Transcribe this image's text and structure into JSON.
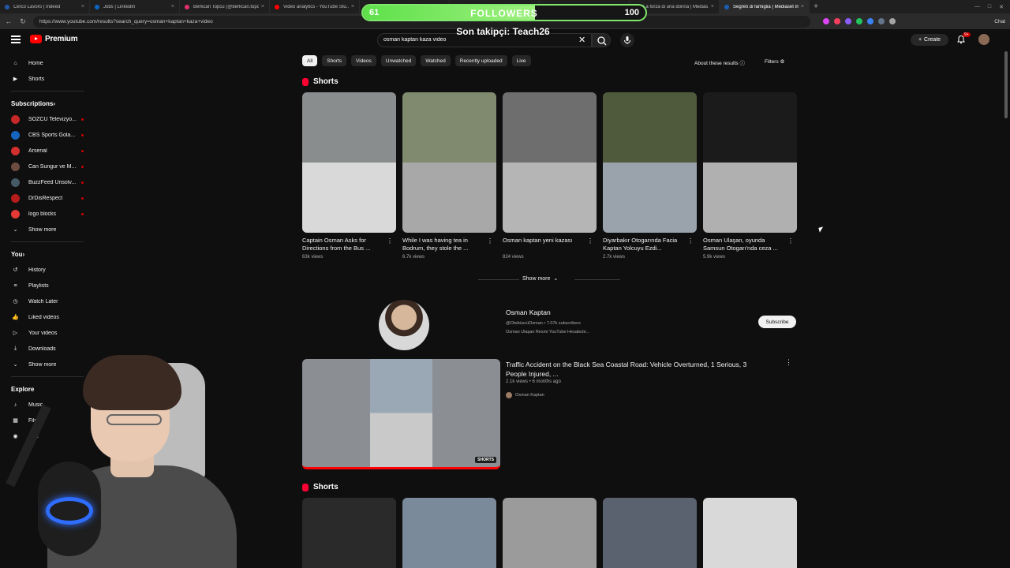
{
  "browser": {
    "tabs": [
      {
        "title": "Cerco Lavoro | Indeed",
        "color": "#2557a7"
      },
      {
        "title": "Jobs | LinkedIn",
        "color": "#0a66c2"
      },
      {
        "title": "Berkcan Topcu (@berkcan.topc...",
        "color": "#e1306c"
      },
      {
        "title": "Video analytics - YouTube Stu...",
        "color": "#ff0000"
      },
      {
        "title": "",
        "color": "#333"
      },
      {
        "title": "Canale 5: video, puntate, pal...",
        "color": "#1a5fb4"
      },
      {
        "title": "Innocence | Mediaset Infinity",
        "color": "#1a5fb4"
      },
      {
        "title": "La forza di una donna | Medias...",
        "color": "#1a5fb4"
      },
      {
        "title": "Segreti di famiglia | Mediaset In...",
        "color": "#1a5fb4"
      }
    ],
    "url": "https://www.youtube.com/results?search_query=osman+kaptan+kaza+video",
    "chat_label": "Chat"
  },
  "overlay": {
    "followers_label": "FOLLOWERS",
    "followers_current": "61",
    "followers_goal": "100",
    "followers_progress": 0.61,
    "last_follower": "Son takipçi: Teach26"
  },
  "header": {
    "logo_text": "Premium",
    "search_value": "osman kaptan kaza video",
    "create_label": "Create",
    "notifications_badge": "9+"
  },
  "sidebar": {
    "main": [
      {
        "label": "Home",
        "icon": "home-icon"
      },
      {
        "label": "Shorts",
        "icon": "shorts-icon"
      }
    ],
    "subscriptions_title": "Subscriptions",
    "subscriptions": [
      {
        "label": "SÖZCÜ Televizyo...",
        "color": "#c62828"
      },
      {
        "label": "CBS Sports Gola...",
        "color": "#1565c0"
      },
      {
        "label": "Arsenal",
        "color": "#d32f2f"
      },
      {
        "label": "Can Sungur ve M...",
        "color": "#6d4c41"
      },
      {
        "label": "BuzzFeed Unsolv...",
        "color": "#455a64"
      },
      {
        "label": "DrDisRespect",
        "color": "#b71c1c"
      },
      {
        "label": "logo blocks",
        "color": "#e53935"
      }
    ],
    "show_more": "Show more",
    "you_title": "You",
    "you_items": [
      {
        "label": "History",
        "icon": "history-icon"
      },
      {
        "label": "Playlists",
        "icon": "playlists-icon"
      },
      {
        "label": "Watch Later",
        "icon": "clock-icon"
      },
      {
        "label": "Liked videos",
        "icon": "thumbs-up-icon"
      },
      {
        "label": "Your videos",
        "icon": "video-icon"
      },
      {
        "label": "Downloads",
        "icon": "download-icon"
      }
    ],
    "show_more_2": "Show more",
    "explore_title": "Explore",
    "explore_items": [
      {
        "label": "Music",
        "icon": "music-icon"
      },
      {
        "label": "Films",
        "icon": "film-icon"
      },
      {
        "label": "Live",
        "icon": "live-icon"
      }
    ]
  },
  "chips": [
    "All",
    "Shorts",
    "Videos",
    "Unwatched",
    "Watched",
    "Recently uploaded",
    "Live"
  ],
  "about_results": "About these results",
  "filters_label": "Filters",
  "shorts_section_title": "Shorts",
  "shorts": [
    {
      "title": "Captain Osman Asks for Directions from the Bus ...",
      "views": "63k views",
      "top": "#8a8d8e",
      "bottom": "#d9d9d9"
    },
    {
      "title": "While I was having tea in Bodrum, they stole the ...",
      "views": "6.7k views",
      "top": "#7f8a6e",
      "bottom": "#a8a8a8"
    },
    {
      "title": "Osman kaptan yeni kazası",
      "views": "824 views",
      "top": "#6e6e6e",
      "bottom": "#b5b5b5"
    },
    {
      "title": "Diyarbakır Otogarında Facia Kaptan Yolcuyu Ezdi...",
      "views": "2.7k views",
      "top": "#4f5a3c",
      "bottom": "#9aa3ab"
    },
    {
      "title": "Osman Ulaşan, oyunda Samsun Otogarı'nda ceza ...",
      "views": "5.9k views",
      "top": "#1b1b1b",
      "bottom": "#b0b0b0"
    }
  ],
  "show_more_shorts": "Show more",
  "channel": {
    "name": "Osman Kaptan",
    "meta": "@OtobüscüOsman • 7.07k subscribers",
    "desc": "Osman Ulaşan Resmi YouTube Hesabıdır...",
    "subscribe_label": "Subscribe"
  },
  "video": {
    "title": "Traffic Accident on the Black Sea Coastal Road: Vehicle Overturned, 1 Serious, 3 People Injured, ...",
    "meta": "2.1k views • 6 months ago",
    "channel": "Osman Kaptan",
    "badge": "SHORTS"
  },
  "shorts_section_title_2": "Shorts",
  "shorts_2": [
    {
      "top": "#2a2a2a"
    },
    {
      "top": "#7a8a9a"
    },
    {
      "top": "#9b9b9b"
    },
    {
      "top": "#5a6270"
    },
    {
      "top": "#d9d9d9"
    }
  ]
}
